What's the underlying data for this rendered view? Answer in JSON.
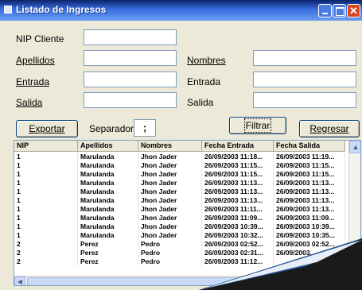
{
  "window": {
    "title": "Listado de Ingresos",
    "close_glyph": "✕"
  },
  "form": {
    "nip_label": "NIP Cliente",
    "apellidos_label": "Apellidos",
    "nombres_label": "Nombres",
    "entrada_label_left": "Entrada",
    "entrada_label_right": "Entrada",
    "salida_label_left": "Salida",
    "salida_label_right": "Salida",
    "separador_label": "Separador",
    "separador_value": ";"
  },
  "buttons": {
    "exportar": "Exportar",
    "filtrar": "Filtrar",
    "regresar": "Regresar"
  },
  "grid": {
    "columns": [
      "NIP",
      "Apellidos",
      "Nombres",
      "Fecha Entrada",
      "Fecha Salida"
    ],
    "rows": [
      [
        "1",
        "Marulanda",
        "Jhon Jader",
        "26/09/2003 11:18...",
        "26/09/2003 11:19..."
      ],
      [
        "1",
        "Marulanda",
        "Jhon Jader",
        "26/09/2003 11:15...",
        "26/09/2003 11:15..."
      ],
      [
        "1",
        "Marulanda",
        "Jhon Jader",
        "26/09/2003 11:15...",
        "26/09/2003 11:15..."
      ],
      [
        "1",
        "Marulanda",
        "Jhon Jader",
        "26/09/2003 11:13...",
        "26/09/2003 11:13..."
      ],
      [
        "1",
        "Marulanda",
        "Jhon Jader",
        "26/09/2003 11:13...",
        "26/09/2003 11:13..."
      ],
      [
        "1",
        "Marulanda",
        "Jhon Jader",
        "26/09/2003 11:13...",
        "26/09/2003 11:13..."
      ],
      [
        "1",
        "Marulanda",
        "Jhon Jader",
        "26/09/2003 11:11...",
        "26/09/2003 11:13..."
      ],
      [
        "1",
        "Marulanda",
        "Jhon Jader",
        "26/09/2003 11:09...",
        "26/09/2003 11:09..."
      ],
      [
        "1",
        "Marulanda",
        "Jhon Jader",
        "26/09/2003 10:39...",
        "26/09/2003 10:39..."
      ],
      [
        "1",
        "Marulanda",
        "Jhon Jader",
        "26/09/2003 10:32...",
        "26/09/2003 10:35..."
      ],
      [
        "2",
        "Perez",
        "Pedro",
        "26/09/2003 02:52...",
        "26/09/2003 02:52..."
      ],
      [
        "2",
        "Perez",
        "Pedro",
        "26/09/2003 02:31...",
        "26/09/2003..."
      ],
      [
        "2",
        "Perez",
        "Pedro",
        "26/09/2003 11:12...",
        ""
      ]
    ]
  },
  "colors": {
    "titlebar": "#0a246a",
    "window_bg": "#ece9d8",
    "close_button": "#d9461e",
    "page_curl": "#1a1a1a"
  },
  "icons": {
    "app": "window-app-icon",
    "minimize": "minimize-icon",
    "maximize": "maximize-icon",
    "close": "close-icon",
    "scroll_up": "scroll-up-arrow-icon",
    "scroll_left": "scroll-left-arrow-icon"
  }
}
